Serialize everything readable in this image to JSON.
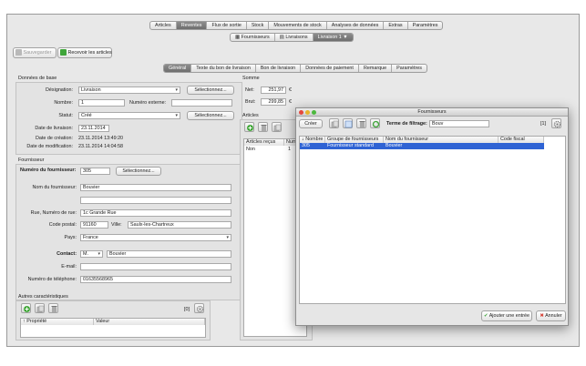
{
  "main_tabs": [
    "Articles",
    "Reventes",
    "Flux de sortie",
    "Stock",
    "Mouvements de stock",
    "Analyses de données",
    "Extras",
    "Paramètres"
  ],
  "main_tabs_active": 1,
  "sub_tabs": {
    "suppliers": "Fournisseurs",
    "deliveries": "Livraisons",
    "current": "Livraison 1"
  },
  "toolbar": {
    "save": "Sauvegarder",
    "receive": "Recevoir les articles"
  },
  "section_tabs": [
    "Général",
    "Texte du bon de livraison",
    "Bon de livraison",
    "Données de paiement",
    "Remarque",
    "Paramètres"
  ],
  "basic": {
    "title": "Données de base",
    "designation_label": "Désignation:",
    "designation_value": "Livraison",
    "select_label": "Sélectionnez...",
    "number_label": "Nombre:",
    "number_value": "1",
    "external_label": "Numéro externe:",
    "external_value": "",
    "status_label": "Statut:",
    "status_value": "Créé",
    "delivery_date_label": "Date de livraison:",
    "delivery_date_value": "23.11.2014",
    "created_label": "Date de création:",
    "created_value": "23.11.2014 13:49:20",
    "modified_label": "Date de modification:",
    "modified_value": "23.11.2014 14:04:58"
  },
  "supplier": {
    "title": "Fournisseur",
    "number_label": "Numéro du fournisseur:",
    "number_value": "305",
    "select_label": "Sélectionnez...",
    "name_label": "Nom du fournisseur:",
    "name_value": "Bouvier",
    "name2_value": "",
    "street_label": "Rue, Numéro de rue:",
    "street_value": "1c Grande Rue",
    "zip_label": "Code postal:",
    "zip_value": "91160",
    "city_label": "Ville:",
    "city_value": "Saulx-les-Chartreux",
    "country_label": "Pays:",
    "country_value": "France",
    "contact_label": "Contact:",
    "contact_salutation": "M.",
    "contact_name": "Bouvier",
    "email_label": "E-mail:",
    "email_value": "",
    "phone_label": "Numéro de téléphone:",
    "phone_value": "01635568965"
  },
  "other": {
    "title": "Autres caractéristiques",
    "count": "[0]",
    "col_property": "↑ Propriété",
    "col_value": "Valeur"
  },
  "sum": {
    "title": "Somme",
    "net_label": "Net:",
    "net_value": "251,97",
    "gross_label": "Brut:",
    "gross_value": "299,85",
    "currency": "€"
  },
  "articles": {
    "title": "Articles",
    "col_received": "Articles reçus",
    "col_number": "Num",
    "row_received": "Non",
    "row_number": "1"
  },
  "dialog": {
    "title": "Fournisseurs",
    "create": "Créer",
    "filter_label": "Terme de filtrage:",
    "filter_value": "Bouv",
    "count": "[1]",
    "columns": [
      "↓ Nombre",
      "Groupe de fournisseurs",
      "Nom du fournisseur",
      "Code fiscal"
    ],
    "rows": [
      {
        "number": "305",
        "group": "Fournisseur standard",
        "name": "Bouvier",
        "tax": ""
      }
    ],
    "add": "Ajouter une entrée",
    "cancel": "Annuler"
  },
  "colors": {
    "selection": "#2f63d4",
    "active_tab": "#7a7a7a",
    "close_light": "#e5483d",
    "min_light": "#e8b42a",
    "max_light": "#4cb93e"
  },
  "icons": [
    "save-icon",
    "receive-icon",
    "add-icon",
    "trash-icon",
    "copy-icon",
    "refresh-icon",
    "settings-icon",
    "checkmark-icon",
    "cancel-icon"
  ]
}
